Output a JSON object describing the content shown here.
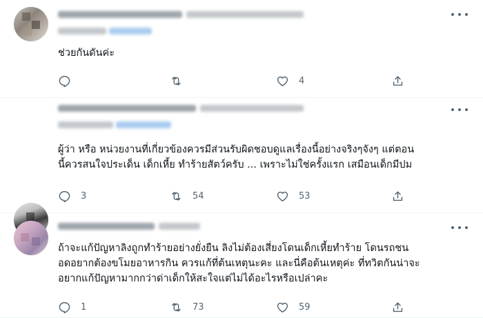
{
  "replies": [
    {
      "text_lines": [
        "ช่วยกันดันค่ะ"
      ],
      "actions": {
        "reply": "",
        "retweet": "",
        "like": "4",
        "share": ""
      }
    },
    {
      "text_lines": [
        "ผู้ว่า หรือ หน่วยงานที่เกี่ยวข้องควรมีส่วนรับผิดชอบดูแลเรื่องนี้อย่างจริงๆจังๆ แต่ตอน",
        "นี้ควรสนใจประเด็น เด็กเหี้ย ทำร้ายสัตว์ครับ ... เพราะไม่ใช่ครั้งแรก เสมือนเด็กมีปม"
      ],
      "actions": {
        "reply": "3",
        "retweet": "54",
        "like": "53",
        "share": ""
      }
    },
    {
      "text_lines": [
        "ถ้าจะแก้ปัญหาลิงถูกทำร้ายอย่างยั่งยืน ลิงไม่ต้องเสี่ยงโดนเด็กเหี้ยทำร้าย โดนรถชน",
        "อดอยากต้องขโมยอาหารกิน ควรแก้ที่ต้นเหตุนะคะ และนี่คือต้นเหตุค่ะ ที่ทวิตกันน่าจะ",
        "อยากแก้ปัญหามากกว่าด่าเด็กให้สะใจแต่ไม่ได้อะไรหรือเปล่าคะ"
      ],
      "actions": {
        "reply": "1",
        "retweet": "73",
        "like": "59",
        "share": ""
      }
    }
  ],
  "icons": {
    "reply": "reply-icon",
    "retweet": "retweet-icon",
    "like": "heart-icon",
    "share": "share-icon",
    "more": "more-icon"
  },
  "colors": {
    "text": "#0f1419",
    "muted": "#536471",
    "divider": "#eff3f4"
  }
}
